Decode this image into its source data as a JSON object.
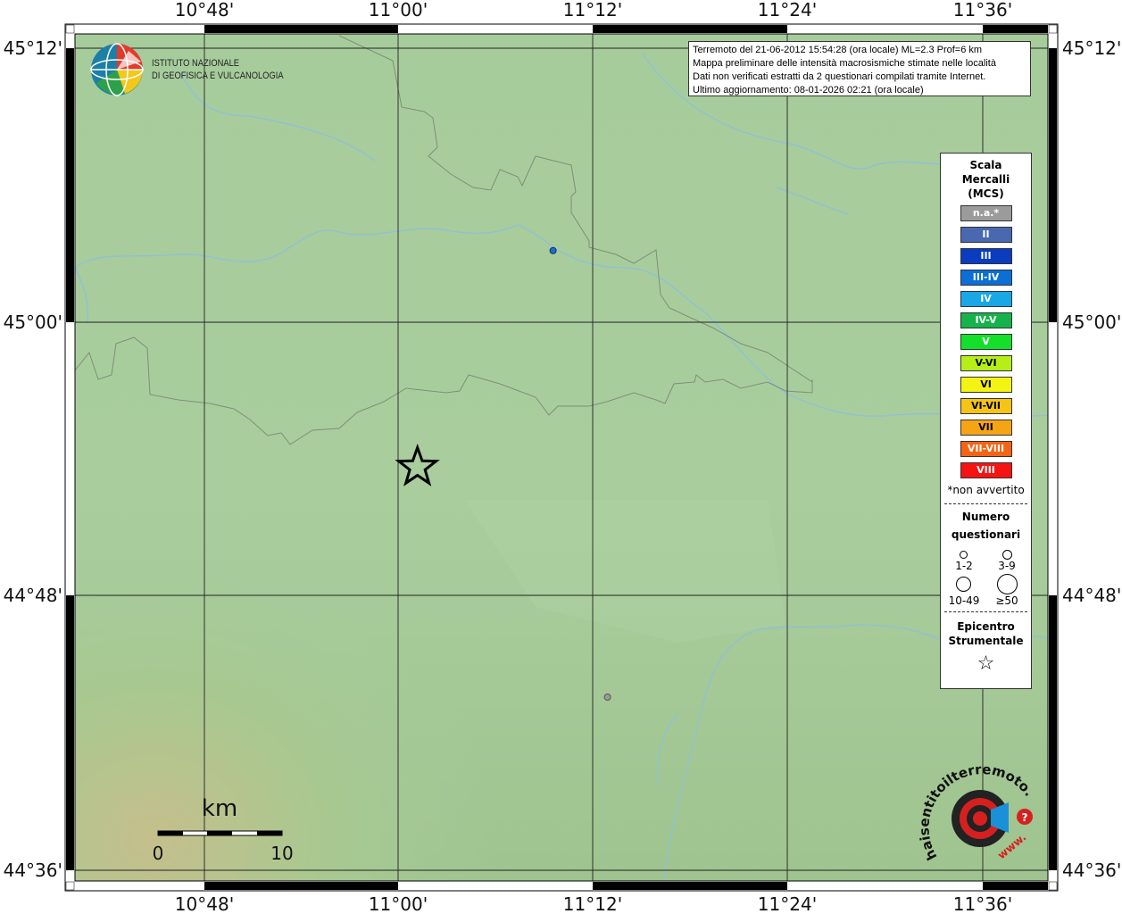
{
  "colors": {
    "land": "#a6cc9b",
    "river": "#8fc0d8",
    "border": "#7e8f79",
    "grid": "#222222",
    "epicenter": "#000000"
  },
  "axes": {
    "top_labels": [
      "10°48'",
      "11°00'",
      "11°12'",
      "11°24'",
      "11°36'"
    ],
    "bottom_labels": [
      "10°48'",
      "11°00'",
      "11°12'",
      "11°24'",
      "11°36'"
    ],
    "left_labels": [
      "45°12'",
      "45°00'",
      "44°48'",
      "44°36'"
    ],
    "right_labels": [
      "45°12'",
      "45°00'",
      "44°48'",
      "44°36'"
    ]
  },
  "info": {
    "line1": "Terremoto del 21-06-2012 15:54:28 (ora locale) ML=2.3 Prof=6 km",
    "line2": "Mappa preliminare delle intensità macrosismiche stimate nelle località",
    "line3": "Dati non verificati estratti da 2 questionari compilati tramite Internet.",
    "line4": "Ultimo aggiornamento: 08-01-2026 02:21 (ora locale)"
  },
  "institute": {
    "line1": "ISTITUTO NAZIONALE",
    "line2": "DI GEOFISICA E VULCANOLOGIA"
  },
  "legend": {
    "title_l1": "Scala",
    "title_l2": "Mercalli",
    "title_l3": "(MCS)",
    "intensity_levels": [
      {
        "label": "n.a.*",
        "color": "#9b9b9b"
      },
      {
        "label": "II",
        "color": "#4a68b0"
      },
      {
        "label": "III",
        "color": "#0a3cc0"
      },
      {
        "label": "III-IV",
        "color": "#0b6fd6"
      },
      {
        "label": "IV",
        "color": "#1aa7e6"
      },
      {
        "label": "IV-V",
        "color": "#16b24c"
      },
      {
        "label": "V",
        "color": "#14e02c"
      },
      {
        "label": "V-VI",
        "color": "#b6ee18"
      },
      {
        "label": "VI",
        "color": "#f4f414"
      },
      {
        "label": "VI-VII",
        "color": "#f5c414"
      },
      {
        "label": "VII",
        "color": "#f5a414"
      },
      {
        "label": "VII-VIII",
        "color": "#f46414"
      },
      {
        "label": "VIII",
        "color": "#f41414"
      }
    ],
    "note": "*non avvertito",
    "count_title_l1": "Numero",
    "count_title_l2": "questionari",
    "count_bins": [
      "1-2",
      "3-9",
      "10-49",
      "≥50"
    ],
    "epicenter_l1": "Epicentro",
    "epicenter_l2": "Strumentale",
    "epicenter_symbol": "☆"
  },
  "scale_bar": {
    "unit": "km",
    "min_label": "0",
    "max_label": "10"
  },
  "logo_hst": {
    "text_arc": "haisentitoilterremoto.it",
    "url_part": "www."
  },
  "events": {
    "epicenter": {
      "lon": 11.063,
      "lat": 44.89
    },
    "points": [
      {
        "lon": 11.2,
        "lat": 45.055,
        "color": "#1a70c8"
      },
      {
        "lon": 11.255,
        "lat": 44.715,
        "color": "#9b9b9b"
      }
    ]
  },
  "map_extent": {
    "lon_min": 10.717,
    "lon_max": 11.7,
    "lat_min": 44.575,
    "lat_max": 45.22
  }
}
